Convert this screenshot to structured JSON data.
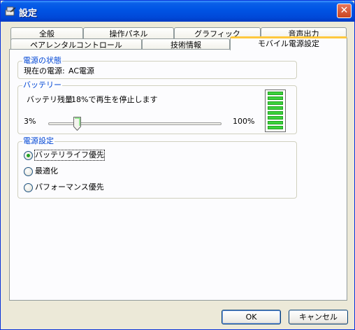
{
  "window": {
    "title": "設定",
    "icon": "settings-app-icon",
    "close_label": "✕"
  },
  "tabs_back": [
    "全般",
    "操作パネル",
    "グラフィック",
    "音声出力"
  ],
  "tabs_front": [
    "ペアレンタルコントロール",
    "技術情報",
    "モバイル電源設定"
  ],
  "active_tab": "モバイル電源設定",
  "power_state": {
    "title": "電源の状態",
    "label": "現在の電源:",
    "value": "AC電源"
  },
  "battery": {
    "title": "バッテリー",
    "label": "バッテリ残量",
    "threshold_text": "18%で再生を停止します",
    "min_label": "3%",
    "max_label": "100%",
    "slider_value_percent": 18,
    "level_bars_filled": 8,
    "level_bars_total": 8,
    "level_color": "#3bd23b"
  },
  "power_settings": {
    "title": "電源設定",
    "options": [
      "バッテリライフ優先",
      "最適化",
      "パフォーマンス優先"
    ],
    "selected": "バッテリライフ優先"
  },
  "buttons": {
    "ok": "OK",
    "cancel": "キャンセル"
  },
  "colors": {
    "titlebar": "#0055e5",
    "accent_text": "#0046d5",
    "tab_highlight": "#ffc83c"
  }
}
